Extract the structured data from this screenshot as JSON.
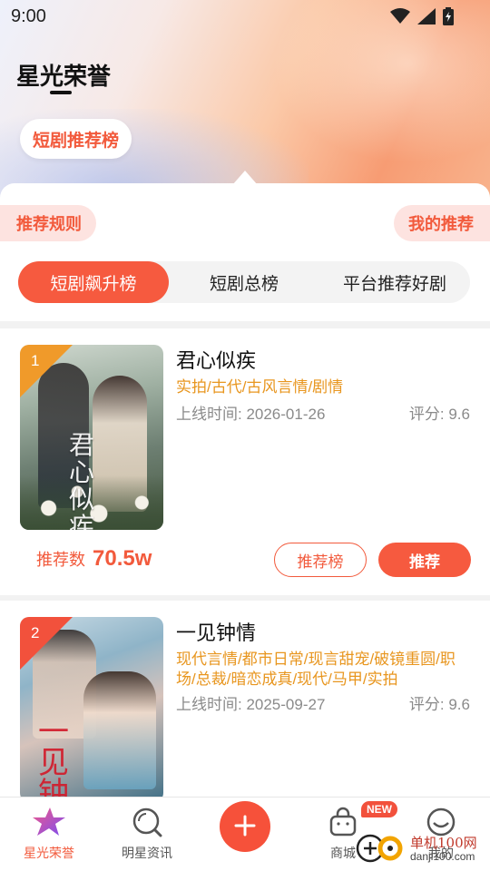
{
  "status": {
    "time": "9:00",
    "icons": [
      "wifi-icon",
      "signal-icon",
      "battery-charging-icon"
    ]
  },
  "header": {
    "title": "星光荣誉",
    "chip": "短剧推荐榜"
  },
  "panel": {
    "left_tag": "推荐规则",
    "right_tag": "我的推荐"
  },
  "tabs": [
    {
      "label": "短剧飙升榜",
      "active": true
    },
    {
      "label": "短剧总榜",
      "active": false
    },
    {
      "label": "平台推荐好剧",
      "active": false
    }
  ],
  "items": [
    {
      "rank": "1",
      "title": "君心似疾",
      "poster_text": "君心似疾",
      "genres": "实拍/古代/古风言情/剧情",
      "release": "上线时间: 2026-01-26",
      "score": "评分: 9.6",
      "rec_label": "推荐数",
      "rec_value": "70.5w",
      "btn_rank": "推荐榜",
      "btn_recommend": "推荐"
    },
    {
      "rank": "2",
      "title": "一见钟情",
      "poster_text": "一见钟情",
      "genres": "现代言情/都市日常/现言甜宠/破镜重圆/职场/总裁/暗恋成真/现代/马甲/实拍",
      "release": "上线时间: 2025-09-27",
      "score": "评分: 9.6"
    }
  ],
  "bottom_nav": {
    "home": "星光荣誉",
    "news": "明星资讯",
    "mall": "商城",
    "mine": "我的",
    "new_badge": "NEW",
    "accent": "#f25a3c"
  },
  "watermark": {
    "cn": "单机100网",
    "en": "danji100.com"
  }
}
